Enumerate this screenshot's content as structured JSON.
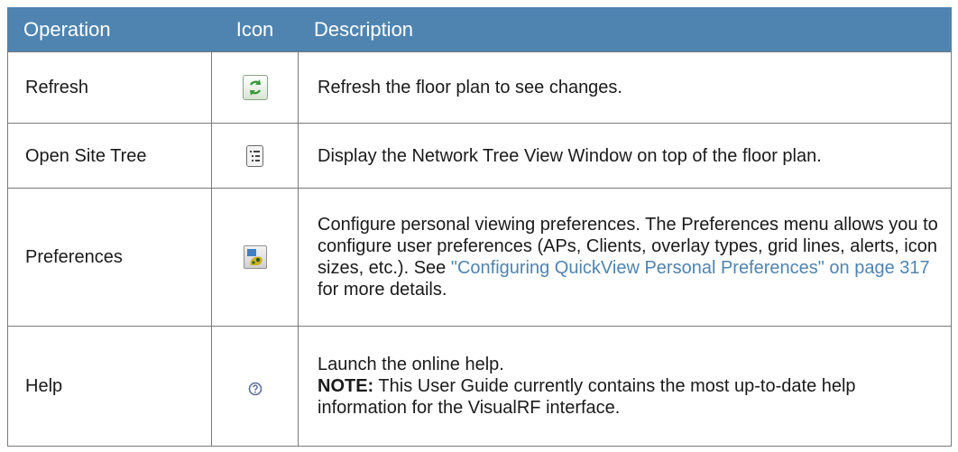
{
  "table": {
    "headers": {
      "operation": "Operation",
      "icon": "Icon",
      "description": "Description"
    },
    "rows": [
      {
        "operation": "Refresh",
        "icon": "refresh-icon",
        "description": "Refresh the floor plan to see changes."
      },
      {
        "operation": "Open Site Tree",
        "icon": "site-tree-icon",
        "description": "Display the Network Tree View Window on top of the floor plan."
      },
      {
        "operation": "Preferences",
        "icon": "preferences-icon",
        "description_before": "Configure personal viewing preferences. The Preferences menu allows you to configure user preferences (APs, Clients, overlay types, grid lines, alerts, icon sizes, etc.). See ",
        "link_text": "\"Configuring QuickView Personal Preferences\" on page 317",
        "description_after": " for more details."
      },
      {
        "operation": "Help",
        "icon": "help-icon",
        "description_line1": "Launch the online help.",
        "note_label": "NOTE:",
        "note_text": " This User Guide currently contains the most up-to-date help information for the VisualRF interface."
      }
    ]
  },
  "colors": {
    "header_bg": "#4f84b0",
    "header_text": "#ffffff",
    "link": "#4f84b0",
    "border": "#7a7a7a"
  }
}
